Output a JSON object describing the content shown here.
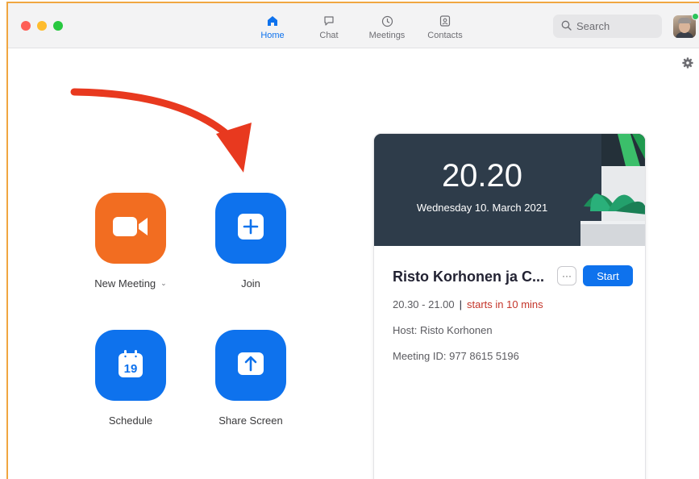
{
  "nav": {
    "tabs": [
      {
        "label": "Home",
        "icon": "home-icon",
        "active": true
      },
      {
        "label": "Chat",
        "icon": "chat-bubble-icon",
        "active": false
      },
      {
        "label": "Meetings",
        "icon": "clock-icon",
        "active": false
      },
      {
        "label": "Contacts",
        "icon": "contact-card-icon",
        "active": false
      }
    ]
  },
  "search": {
    "placeholder": "Search"
  },
  "actions": {
    "new_meeting": "New Meeting",
    "join": "Join",
    "schedule": "Schedule",
    "schedule_day": "19",
    "share_screen": "Share Screen"
  },
  "card": {
    "time": "20.20",
    "date": "Wednesday 10. March 2021",
    "meeting_title": "Risto Korhonen ja C...",
    "more_label": "···",
    "start_label": "Start",
    "time_range": "20.30 - 21.00",
    "separator": "|",
    "starts_in": "starts in 10 mins",
    "host": "Host: Risto Korhonen",
    "meeting_id": "Meeting ID: 977 8615 5196"
  },
  "colors": {
    "accent": "#0e72ed",
    "new_meeting": "#f26d21",
    "annotation_arrow": "#e8391f",
    "window_border": "#f0a640",
    "starts_in": "#c4352a"
  }
}
